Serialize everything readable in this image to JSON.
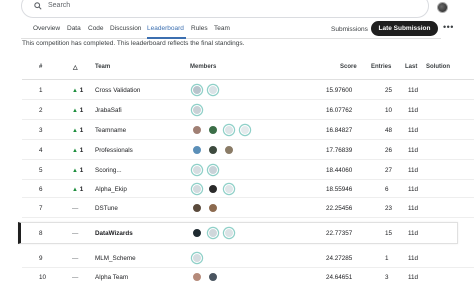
{
  "search": {
    "placeholder": "Search"
  },
  "tabs": [
    "Overview",
    "Data",
    "Code",
    "Discussion",
    "Leaderboard",
    "Rules",
    "Team"
  ],
  "actions": {
    "submissions": "Submissions",
    "late_submission": "Late Submission",
    "more": "•••"
  },
  "notice": "This competition has completed. This leaderboard reflects the final standings.",
  "columns": {
    "rank": "#",
    "change": "△",
    "team": "Team",
    "members": "Members",
    "score": "Score",
    "entries": "Entries",
    "last": "Last",
    "solution": "Solution"
  },
  "rows": [
    {
      "rank": "1",
      "change_arrow": "▲",
      "change": "1",
      "team": "Cross Validation",
      "score": "15.97600",
      "entries": "25",
      "last": "11d"
    },
    {
      "rank": "2",
      "change_arrow": "▲",
      "change": "1",
      "team": "JrabaSafi",
      "score": "16.07762",
      "entries": "10",
      "last": "11d"
    },
    {
      "rank": "3",
      "change_arrow": "▲",
      "change": "1",
      "team": "Teamname",
      "score": "16.84827",
      "entries": "48",
      "last": "11d"
    },
    {
      "rank": "4",
      "change_arrow": "▲",
      "change": "1",
      "team": "Professionals",
      "score": "17.76839",
      "entries": "26",
      "last": "11d"
    },
    {
      "rank": "5",
      "change_arrow": "▲",
      "change": "1",
      "team": "Scoring...",
      "score": "18.44060",
      "entries": "27",
      "last": "11d"
    },
    {
      "rank": "6",
      "change_arrow": "▲",
      "change": "1",
      "team": "Alpha_Ekip",
      "score": "18.55946",
      "entries": "6",
      "last": "11d"
    },
    {
      "rank": "7",
      "change_arrow": "",
      "change": "—",
      "team": "DSTune",
      "score": "22.25456",
      "entries": "23",
      "last": "11d"
    },
    {
      "rank": "8",
      "change_arrow": "",
      "change": "—",
      "team": "DataWizards",
      "score": "22.77357",
      "entries": "15",
      "last": "11d"
    },
    {
      "rank": "9",
      "change_arrow": "",
      "change": "—",
      "team": "MLM_Scheme",
      "score": "24.27285",
      "entries": "1",
      "last": "11d"
    },
    {
      "rank": "10",
      "change_arrow": "",
      "change": "—",
      "team": "Alpha Team",
      "score": "24.64651",
      "entries": "3",
      "last": "11d"
    }
  ],
  "colors": {
    "accent": "#3c6fb0",
    "up": "#1e8e3e",
    "dark_button": "#1f1f1f"
  }
}
